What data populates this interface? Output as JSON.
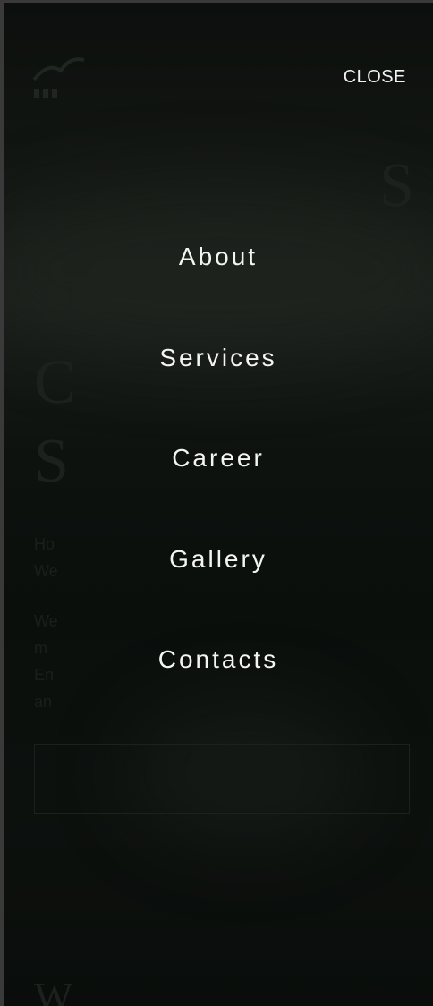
{
  "overlay": {
    "close_label": "CLOSE"
  },
  "menu": {
    "items": [
      {
        "label": "About"
      },
      {
        "label": "Services"
      },
      {
        "label": "Career"
      },
      {
        "label": "Gallery"
      },
      {
        "label": "Contacts"
      }
    ]
  },
  "colors": {
    "overlay_background": "#0c100d",
    "menu_text": "#f4f4f4",
    "frame_border": "#3a3a3a"
  }
}
